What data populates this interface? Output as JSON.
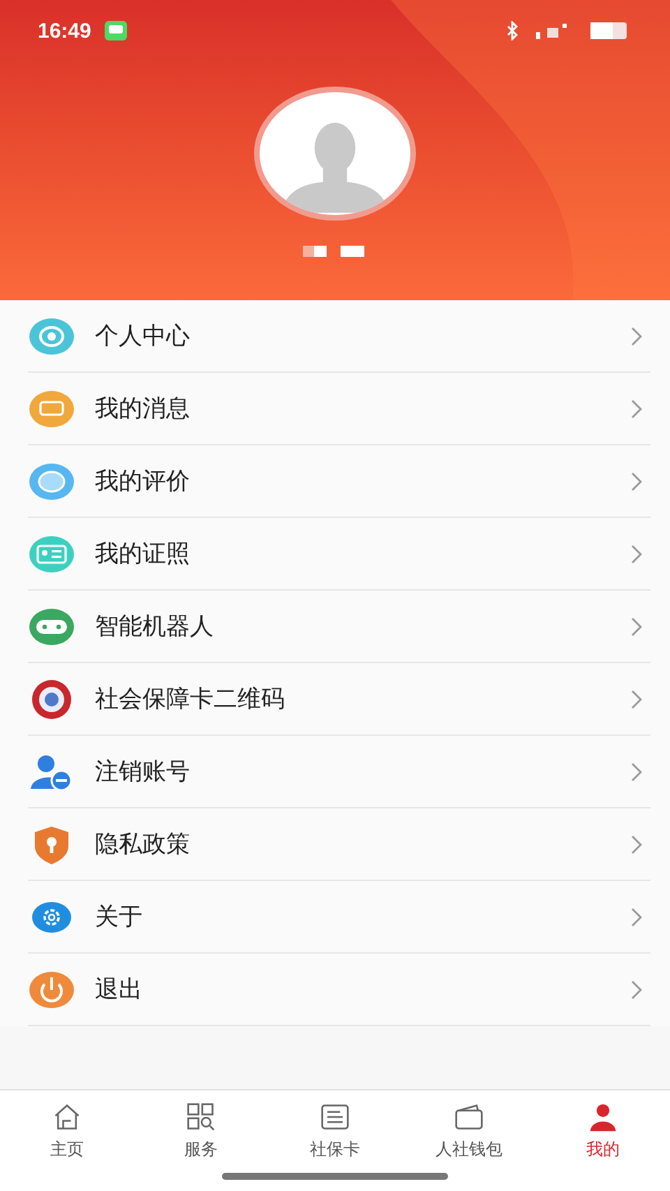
{
  "status_bar": {
    "time": "16:49"
  },
  "menu": [
    {
      "label": "个人中心"
    },
    {
      "label": "我的消息"
    },
    {
      "label": "我的评价"
    },
    {
      "label": "我的证照"
    },
    {
      "label": "智能机器人"
    },
    {
      "label": "社会保障卡二维码"
    },
    {
      "label": "注销账号"
    },
    {
      "label": "隐私政策"
    },
    {
      "label": "关于"
    },
    {
      "label": "退出"
    }
  ],
  "tabs": [
    {
      "label": "主页",
      "selected": false
    },
    {
      "label": "服务",
      "selected": false
    },
    {
      "label": "社保卡",
      "selected": false
    },
    {
      "label": "人社钱包",
      "selected": false
    },
    {
      "label": "我的",
      "selected": true
    }
  ]
}
